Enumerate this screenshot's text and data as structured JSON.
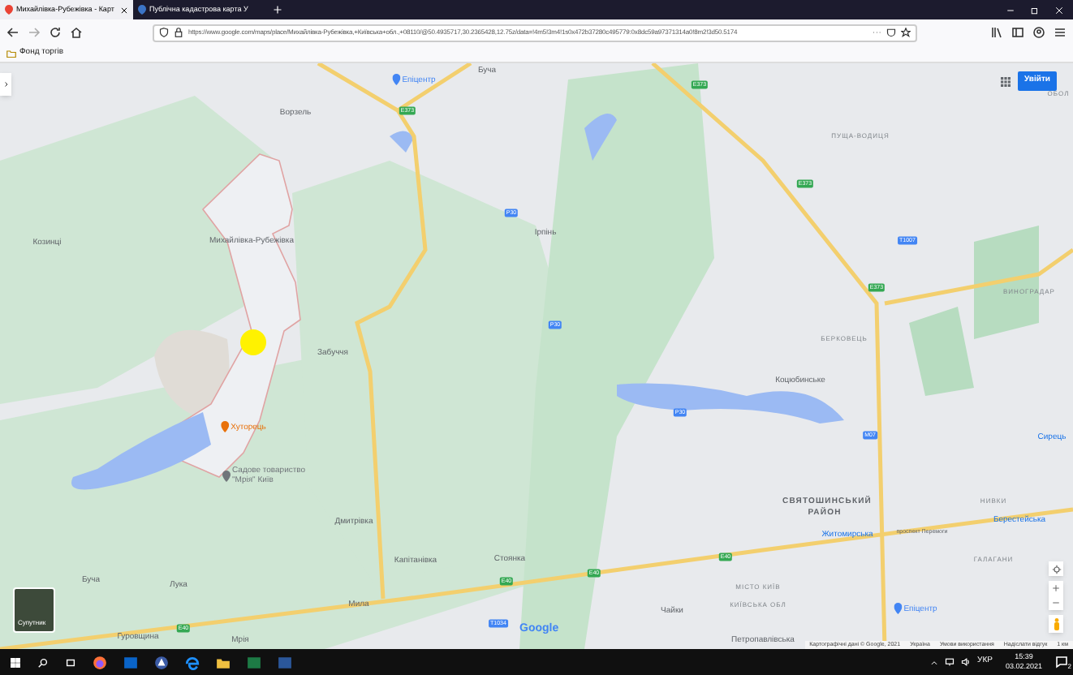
{
  "browser": {
    "tabs": [
      {
        "title": "Михайлівка-Рубежівка - Карт",
        "selected": true
      },
      {
        "title": "Публічна кадастрова карта У",
        "selected": false
      }
    ],
    "url": "https://www.google.com/maps/place/Михайлівка-Рубежівка,+Київська+обл.,+08110/@50.4935717,30.2365428,12.75z/data=!4m5!3m4!1s0x472b37280c495779:0x8dc59a97371314a0!8m2!3d50.5174",
    "bookmarks": [
      "Фонд торгів"
    ]
  },
  "map": {
    "sign_in": "Увійти",
    "satellite_label": "Супутник",
    "logo": "Google",
    "labels": [
      {
        "text": "Буча",
        "kind": "town"
      },
      {
        "text": "Епіцентр",
        "kind": "poi",
        "color": "#4285f4"
      },
      {
        "text": "Ворзель",
        "kind": "town"
      },
      {
        "text": "Козинці",
        "kind": "town"
      },
      {
        "text": "Михайлівка-Рубежівка",
        "kind": "town"
      },
      {
        "text": "Забуччя",
        "kind": "town"
      },
      {
        "text": "Ірпінь",
        "kind": "town"
      },
      {
        "text": "ПУЩА-ВОДИЦЯ",
        "kind": "area"
      },
      {
        "text": "ОБОЛ",
        "kind": "area"
      },
      {
        "text": "ВИНОГРАДАР",
        "kind": "area"
      },
      {
        "text": "БЕРКОВЕЦЬ",
        "kind": "area"
      },
      {
        "text": "Хуторець",
        "kind": "poi",
        "color": "#e8710a"
      },
      {
        "text": "Садове товариство \"Мрія\" Київ",
        "kind": "poi",
        "color": "#70757a"
      },
      {
        "text": "Дмитрівка",
        "kind": "town"
      },
      {
        "text": "Капітанівка",
        "kind": "town"
      },
      {
        "text": "Стоянка",
        "kind": "town"
      },
      {
        "text": "Буча",
        "kind": "town"
      },
      {
        "text": "Лука",
        "kind": "town"
      },
      {
        "text": "Мила",
        "kind": "town"
      },
      {
        "text": "Гуровщина",
        "kind": "town"
      },
      {
        "text": "Мрія",
        "kind": "town"
      },
      {
        "text": "Коцюбинське",
        "kind": "town"
      },
      {
        "text": "СВЯТОШИНСЬКИЙ РАЙОН",
        "kind": "district"
      },
      {
        "text": "Житомирська",
        "kind": "metro"
      },
      {
        "text": "проспект Перемоги",
        "kind": "street"
      },
      {
        "text": "Берестейська",
        "kind": "metro"
      },
      {
        "text": "Сирець",
        "kind": "metro"
      },
      {
        "text": "НИВКИ",
        "kind": "area"
      },
      {
        "text": "ГАЛАГАНИ",
        "kind": "area"
      },
      {
        "text": "МІСТО КИЇВ",
        "kind": "area"
      },
      {
        "text": "КИЇВСЬКА ОБЛ",
        "kind": "area"
      },
      {
        "text": "Чайки",
        "kind": "town"
      },
      {
        "text": "Епіцентр",
        "kind": "poi",
        "color": "#4285f4"
      },
      {
        "text": "Петропавлівська",
        "kind": "town"
      }
    ],
    "shields": [
      {
        "text": "Е373",
        "color": "#34a853"
      },
      {
        "text": "Е373",
        "color": "#34a853"
      },
      {
        "text": "Е373",
        "color": "#34a853"
      },
      {
        "text": "Т1007",
        "color": "#4285f4"
      },
      {
        "text": "Е373",
        "color": "#34a853"
      },
      {
        "text": "Р30",
        "color": "#4285f4"
      },
      {
        "text": "Р30",
        "color": "#4285f4"
      },
      {
        "text": "Р30",
        "color": "#4285f4"
      },
      {
        "text": "М07",
        "color": "#4285f4"
      },
      {
        "text": "Е40",
        "color": "#34a853"
      },
      {
        "text": "Е40",
        "color": "#34a853"
      },
      {
        "text": "Е40",
        "color": "#34a853"
      },
      {
        "text": "Е40",
        "color": "#34a853"
      },
      {
        "text": "Т1034",
        "color": "#4285f4"
      }
    ],
    "footer": [
      "Картографічні дані © Google, 2021",
      "Україна",
      "Умови використання",
      "Надіслати відгук",
      "1 км"
    ]
  },
  "taskbar": {
    "language": "УКР",
    "time": "15:39",
    "date": "03.02.2021",
    "notifications": "2"
  }
}
